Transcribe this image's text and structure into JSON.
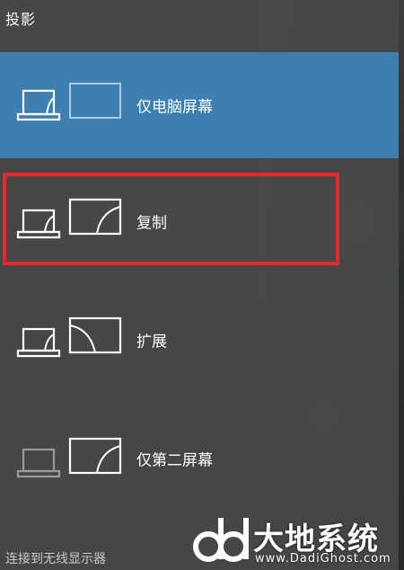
{
  "panel": {
    "title": "投影",
    "options": [
      {
        "label": "仅电脑屏幕",
        "selected": true
      },
      {
        "label": "复制",
        "selected": false,
        "highlighted": true
      },
      {
        "label": "扩展",
        "selected": false
      },
      {
        "label": "仅第二屏幕",
        "selected": false
      }
    ],
    "footer_link": "连接到无线显示器"
  },
  "watermark": {
    "brand": "大地系统",
    "url": "www.DadiGhost.com"
  },
  "colors": {
    "selected_bg": "#3d7fb0",
    "highlight_border": "#e8282c",
    "panel_bg": "#484848"
  }
}
